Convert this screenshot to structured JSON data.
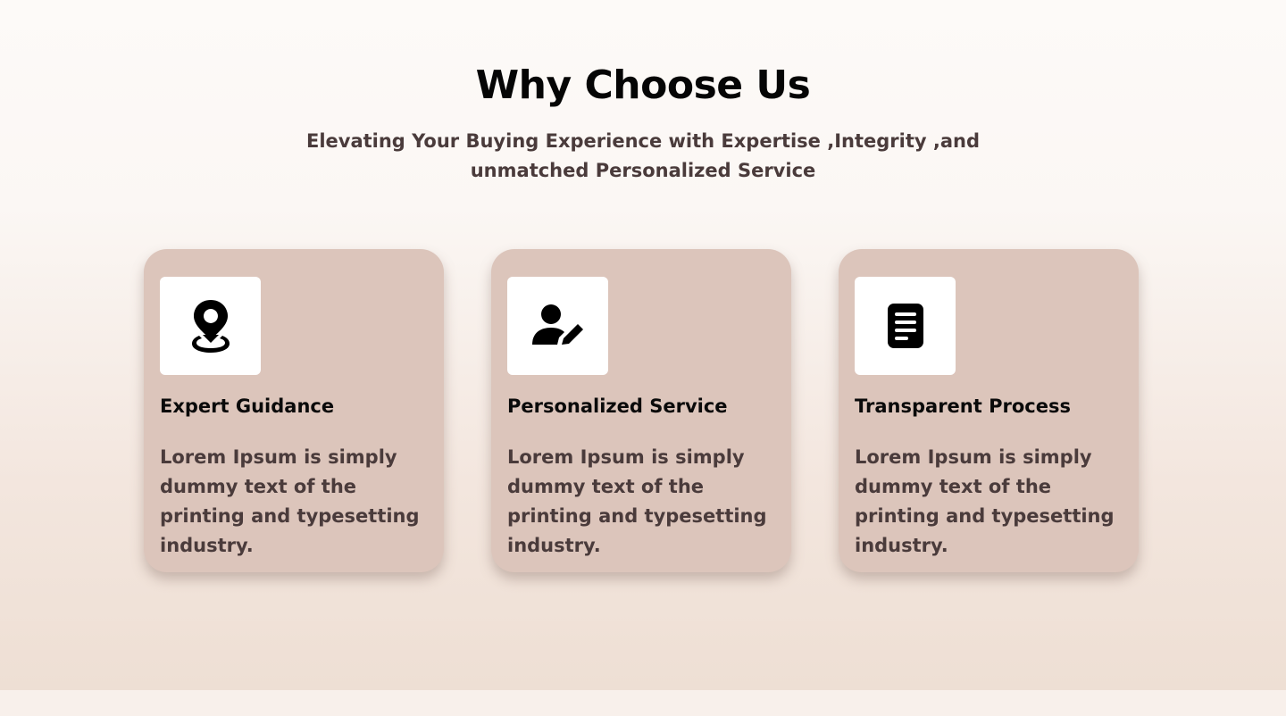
{
  "section": {
    "title": "Why Choose Us",
    "subtitle": "Elevating Your Buying Experience with Expertise ,Integrity ,and unmatched Personalized Service"
  },
  "cards": [
    {
      "icon": "location-pin-icon",
      "title": "Expert Guidance",
      "text": "Lorem Ipsum is simply dummy text of the printing and typesetting industry."
    },
    {
      "icon": "user-edit-icon",
      "title": "Personalized Service",
      "text": "Lorem Ipsum is simply dummy text of the printing and typesetting industry."
    },
    {
      "icon": "document-icon",
      "title": "Transparent Process",
      "text": "Lorem Ipsum is simply dummy text of the printing and typesetting industry."
    }
  ],
  "colors": {
    "card_background": "#dcc5bb",
    "icon_box": "#ffffff",
    "heading": "#050505",
    "body_text": "#4a3b3b"
  }
}
